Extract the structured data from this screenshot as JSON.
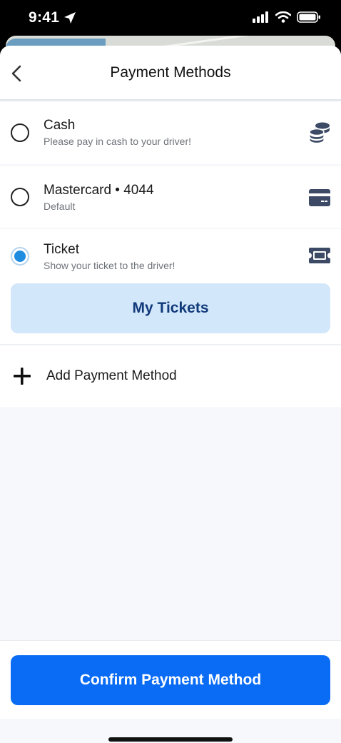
{
  "status_bar": {
    "time": "9:41"
  },
  "header": {
    "title": "Payment Methods"
  },
  "payment_options": [
    {
      "title": "Cash",
      "subtitle": "Please pay in cash to your driver!",
      "icon": "coins-icon",
      "selected": false
    },
    {
      "title": "Mastercard • 4044",
      "subtitle": "Default",
      "icon": "credit-card-icon",
      "selected": false
    },
    {
      "title": "Ticket",
      "subtitle": "Show your ticket to the driver!",
      "icon": "ticket-icon",
      "selected": true
    }
  ],
  "tickets_button": {
    "label": "My Tickets"
  },
  "add_payment": {
    "label": "Add Payment Method"
  },
  "confirm_button": {
    "label": "Confirm Payment Method"
  },
  "colors": {
    "primary": "#0a6cf5",
    "tickets_button_bg": "#d3e7fb",
    "tickets_button_text": "#113a7a",
    "radio_selected": "#1f8ce0",
    "icon": "#3d4a66"
  }
}
